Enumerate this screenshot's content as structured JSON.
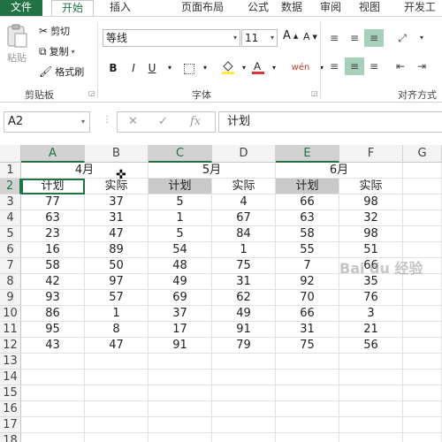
{
  "tabs": [
    {
      "label": "文件",
      "type": "file"
    },
    {
      "label": "开始",
      "type": "active"
    },
    {
      "label": "插入",
      "type": "normal"
    },
    {
      "label": "页面布局",
      "type": "normal"
    },
    {
      "label": "公式",
      "type": "normal"
    },
    {
      "label": "数据",
      "type": "normal"
    },
    {
      "label": "审阅",
      "type": "normal"
    },
    {
      "label": "视图",
      "type": "normal"
    },
    {
      "label": "开发工",
      "type": "normal"
    }
  ],
  "clipboard": {
    "paste": "粘贴",
    "cut": "剪切",
    "copy": "复制",
    "format_painter": "格式刷",
    "group_label": "剪贴板"
  },
  "font": {
    "name": "等线",
    "size": "11",
    "grow": "A",
    "shrink": "A",
    "bold": "B",
    "italic": "I",
    "underline": "U",
    "phonetic": "wén",
    "group_label": "字体"
  },
  "alignment": {
    "group_label": "对齐方式"
  },
  "formula_bar": {
    "name_box": "A2",
    "cancel": "✕",
    "confirm": "✓",
    "fx": "fx",
    "formula": "计划"
  },
  "colors": {
    "excel_green": "#217346",
    "font_color_red": "#e03030",
    "fill_yellow": "#ffeb3b",
    "highlight_gray": "#c9c9c9"
  },
  "sheet": {
    "columns": [
      "A",
      "B",
      "C",
      "D",
      "E",
      "F",
      "G"
    ],
    "row_numbers": [
      "1",
      "2",
      "3",
      "4",
      "5",
      "6",
      "7",
      "8",
      "9",
      "10",
      "11",
      "12",
      "13",
      "14",
      "15",
      "16",
      "17",
      "18"
    ],
    "month_headers": [
      "4月",
      "5月",
      "6月"
    ],
    "sub_headers": [
      "计划",
      "实际",
      "计划",
      "实际",
      "计划",
      "实际"
    ],
    "rows": [
      [
        "77",
        "37",
        "5",
        "4",
        "66",
        "98"
      ],
      [
        "63",
        "31",
        "1",
        "67",
        "63",
        "32"
      ],
      [
        "23",
        "47",
        "5",
        "84",
        "58",
        "98"
      ],
      [
        "16",
        "89",
        "54",
        "1",
        "55",
        "51"
      ],
      [
        "58",
        "50",
        "48",
        "75",
        "7",
        "66"
      ],
      [
        "42",
        "97",
        "49",
        "31",
        "92",
        "35"
      ],
      [
        "93",
        "57",
        "69",
        "62",
        "70",
        "76"
      ],
      [
        "86",
        "1",
        "37",
        "49",
        "66",
        "3"
      ],
      [
        "95",
        "8",
        "17",
        "91",
        "31",
        "21"
      ],
      [
        "43",
        "47",
        "91",
        "79",
        "75",
        "56"
      ]
    ]
  },
  "watermark": "Bai du 经验"
}
